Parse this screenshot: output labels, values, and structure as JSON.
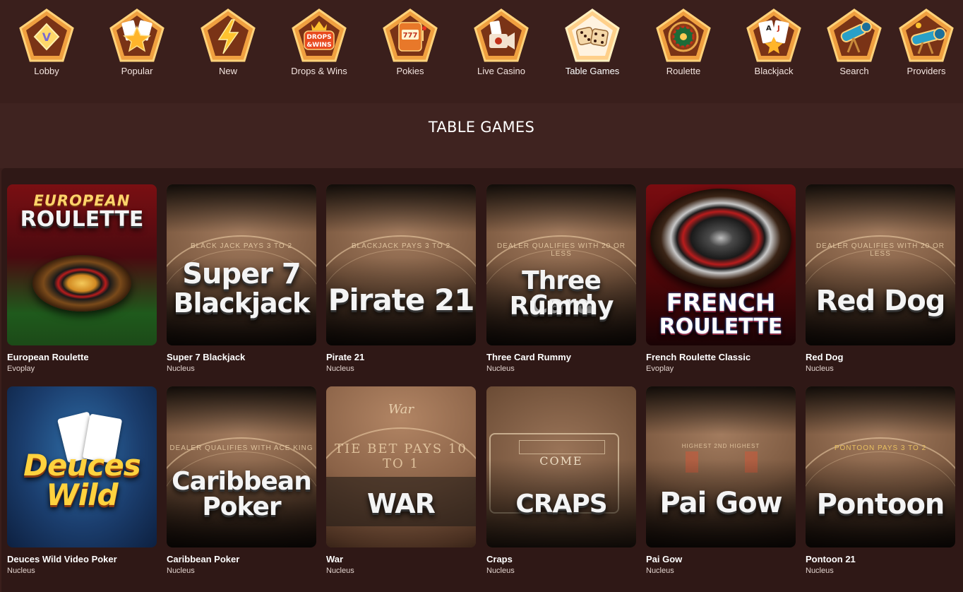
{
  "nav": {
    "items": [
      {
        "label": "Lobby",
        "icon": "lobby-diamond-icon"
      },
      {
        "label": "Popular",
        "icon": "popular-star-cards-icon"
      },
      {
        "label": "New",
        "icon": "new-lightning-icon"
      },
      {
        "label": "Drops & Wins",
        "icon": "drops-wins-crown-icon"
      },
      {
        "label": "Pokies",
        "icon": "pokies-slot-machine-icon"
      },
      {
        "label": "Live Casino",
        "icon": "live-casino-camera-icon"
      },
      {
        "label": "Table Games",
        "icon": "table-games-dice-icon"
      },
      {
        "label": "Roulette",
        "icon": "roulette-wheel-icon"
      },
      {
        "label": "Blackjack",
        "icon": "blackjack-cards-icon"
      },
      {
        "label": "Search",
        "icon": "search-telescope-icon"
      },
      {
        "label": "Providers",
        "icon": "providers-telescope-icon"
      }
    ],
    "active": "Table Games",
    "icon_bg": "#e8963c",
    "icon_inner": "#7a3a1a"
  },
  "section": {
    "title": "TABLE GAMES"
  },
  "games": [
    {
      "title": "European Roulette",
      "provider": "Evoplay",
      "art_top": "EUROPEAN",
      "art_bottom": "ROULETTE"
    },
    {
      "title": "Super 7 Blackjack",
      "provider": "Nucleus",
      "art_top": "Super 7",
      "art_bottom": "Blackjack",
      "felt": "BLACK JACK PAYS 3 TO 2"
    },
    {
      "title": "Pirate 21",
      "provider": "Nucleus",
      "art_top": "Pirate 21",
      "art_bottom": "",
      "felt": "BLACKJACK PAYS 3 TO 2"
    },
    {
      "title": "Three Card Rummy",
      "provider": "Nucleus",
      "art_top": "Three Card",
      "art_bottom": "Rummy",
      "felt": "DEALER QUALIFIES WITH 20 OR LESS"
    },
    {
      "title": "French Roulette Classic",
      "provider": "Evoplay",
      "art_top": "FRENCH",
      "art_bottom": "ROULETTE"
    },
    {
      "title": "Red Dog",
      "provider": "Nucleus",
      "art_top": "Red Dog",
      "art_bottom": "",
      "felt": "DEALER QUALIFIES WITH 20 OR LESS"
    },
    {
      "title": "Deuces Wild Video Poker",
      "provider": "Nucleus",
      "art_top": "Deuces",
      "art_bottom": "Wild"
    },
    {
      "title": "Caribbean Poker",
      "provider": "Nucleus",
      "art_top": "Caribbean",
      "art_bottom": "Poker",
      "felt": "DEALER QUALIFIES WITH ACE KING"
    },
    {
      "title": "War",
      "provider": "Nucleus",
      "art_top": "WAR",
      "art_bottom": "",
      "felt": "TIE BET PAYS 10 TO 1",
      "felt_title": "War"
    },
    {
      "title": "Craps",
      "provider": "Nucleus",
      "art_top": "CRAPS",
      "art_bottom": "",
      "felt": "COME"
    },
    {
      "title": "Pai Gow",
      "provider": "Nucleus",
      "art_top": "Pai Gow",
      "art_bottom": "",
      "felt": "HIGHEST   2ND HIGHEST"
    },
    {
      "title": "Pontoon 21",
      "provider": "Nucleus",
      "art_top": "Pontoon",
      "art_bottom": "",
      "felt": "PONTOON PAYS 3 TO 2"
    }
  ]
}
